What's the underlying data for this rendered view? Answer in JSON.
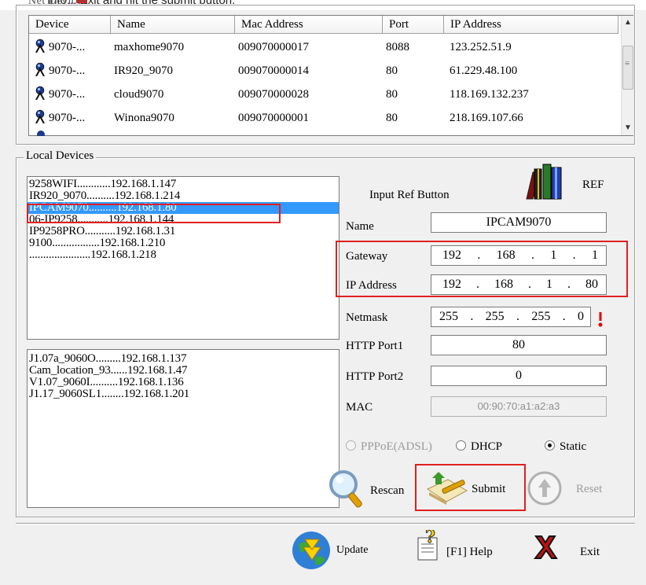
{
  "top_hint": {
    "text": "Info... Exit and hit the submit button.",
    "clipped_label": "Net Devices"
  },
  "net_devices": {
    "columns": [
      "Device",
      "Name",
      "Mac Address",
      "Port",
      "IP Address"
    ],
    "rows": [
      {
        "device": "9070-...",
        "name": "maxhome9070",
        "mac": "009070000017",
        "port": "8088",
        "ip": "123.252.51.9"
      },
      {
        "device": "9070-...",
        "name": "IR920_9070",
        "mac": "009070000014",
        "port": "80",
        "ip": "61.229.48.100"
      },
      {
        "device": "9070-...",
        "name": "cloud9070",
        "mac": "009070000028",
        "port": "80",
        "ip": "118.169.132.237"
      },
      {
        "device": "9070-...",
        "name": "Winona9070",
        "mac": "009070000001",
        "port": "80",
        "ip": "218.169.107.66"
      }
    ]
  },
  "local_devices": {
    "title": "Local Devices",
    "list_top": [
      "9258WIFI............192.168.1.147",
      "IR920_9070..........192.168.1.214",
      "IPCAM9070..........192.168.1.80",
      "06-IP9258...........192.168.1.144",
      "IP9258PRO...........192.168.1.31",
      "9100.................192.168.1.210",
      "......................192.168.1.218"
    ],
    "selected_index": 2,
    "list_bottom": [
      "J1.07a_9060O.........192.168.1.137",
      "Cam_location_93......192.168.1.47",
      "V1.07_9060I..........192.168.1.136",
      "J1.17_9060SL1........192.168.1.201"
    ]
  },
  "form": {
    "input_ref_label": "Input Ref Button",
    "ref_label": "REF",
    "name_label": "Name",
    "name_value": "IPCAM9070",
    "gateway_label": "Gateway",
    "gateway": [
      "192",
      "168",
      "1",
      "1"
    ],
    "ip_label": "IP Address",
    "ip": [
      "192",
      "168",
      "1",
      "80"
    ],
    "netmask_label": "Netmask",
    "netmask": [
      "255",
      "255",
      "255",
      "0"
    ],
    "http1_label": "HTTP Port1",
    "http1_value": "80",
    "http2_label": "HTTP Port2",
    "http2_value": "0",
    "mac_label": "MAC",
    "mac_value": "00:90:70:a1:a2:a3",
    "radio": {
      "pppoe": "PPPoE(ADSL)",
      "dhcp": "DHCP",
      "static": "Static",
      "selected": "static"
    },
    "rescan_label": "Rescan",
    "submit_label": "Submit",
    "reset_label": "Reset"
  },
  "bottom_bar": {
    "update_label": "Update",
    "help_label": "[F1] Help",
    "exit_label": "Exit"
  },
  "colors": {
    "selection": "#3399ff",
    "highlight_red": "#e02020",
    "window_bg": "#f0f0f0"
  }
}
